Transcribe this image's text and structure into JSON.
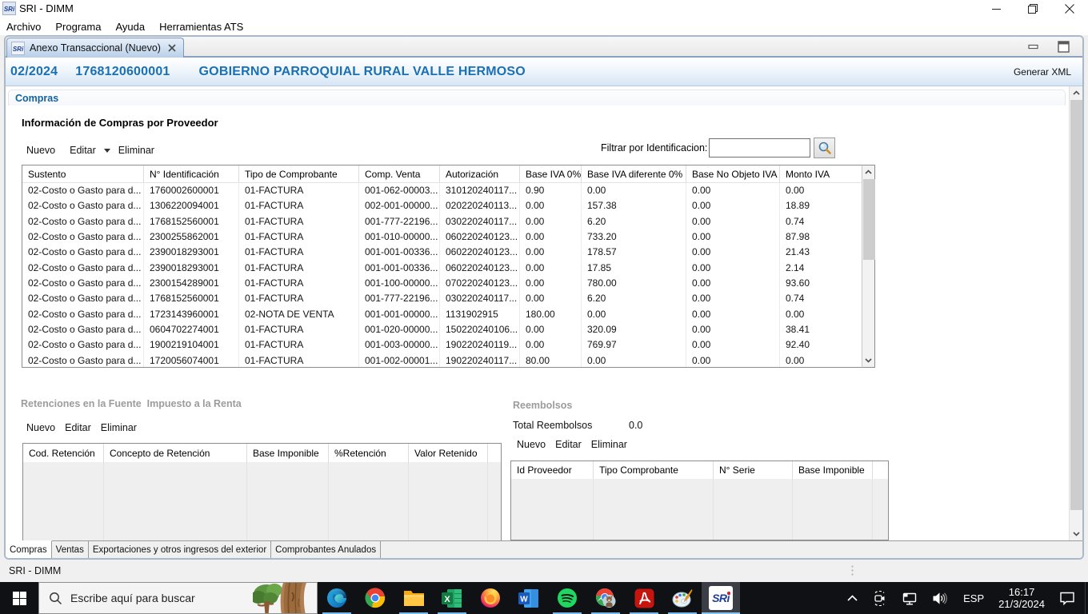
{
  "window": {
    "title": "SRI - DIMM",
    "logo_text": "SRi",
    "controls": [
      "minimize",
      "restore",
      "close"
    ]
  },
  "menu": {
    "items": [
      "Archivo",
      "Programa",
      "Ayuda",
      "Herramientas ATS"
    ]
  },
  "editor_tab": {
    "logo_text": "SRi",
    "label": "Anexo Transaccional (Nuevo)"
  },
  "header": {
    "period": "02/2024",
    "ruc": "1768120600001",
    "entity": "GOBIERNO PARROQUIAL RURAL VALLE HERMOSO",
    "generate_xml_label": "Generar XML"
  },
  "compras": {
    "section_title": "Compras",
    "subtitle": "Información de Compras por Proveedor",
    "toolbar": {
      "new": "Nuevo",
      "edit": "Editar",
      "delete": "Eliminar"
    },
    "filter": {
      "label": "Filtrar por Identificacion:",
      "value": "",
      "button_icon": "magnifier-icon"
    },
    "table": {
      "headers": [
        "Sustento",
        "N° Identificación",
        "Tipo de Comprobante",
        "Comp. Venta",
        "Autorización",
        "Base IVA 0%",
        "Base IVA diferente 0%",
        "Base No Objeto IVA",
        "Monto IVA"
      ],
      "rows": [
        [
          "02-Costo o Gasto para d...",
          "1760002600001",
          "01-FACTURA",
          "001-062-00003...",
          "310120240117...",
          "0.90",
          "0.00",
          "0.00",
          "0.00"
        ],
        [
          "02-Costo o Gasto para d...",
          "1306220094001",
          "01-FACTURA",
          "002-001-00000...",
          "020220240113...",
          "0.00",
          "157.38",
          "0.00",
          "18.89"
        ],
        [
          "02-Costo o Gasto para d...",
          "1768152560001",
          "01-FACTURA",
          "001-777-22196...",
          "030220240117...",
          "0.00",
          "6.20",
          "0.00",
          "0.74"
        ],
        [
          "02-Costo o Gasto para d...",
          "2300255862001",
          "01-FACTURA",
          "001-010-00000...",
          "060220240123...",
          "0.00",
          "733.20",
          "0.00",
          "87.98"
        ],
        [
          "02-Costo o Gasto para d...",
          "2390018293001",
          "01-FACTURA",
          "001-001-00336...",
          "060220240123...",
          "0.00",
          "178.57",
          "0.00",
          "21.43"
        ],
        [
          "02-Costo o Gasto para d...",
          "2390018293001",
          "01-FACTURA",
          "001-001-00336...",
          "060220240123...",
          "0.00",
          "17.85",
          "0.00",
          "2.14"
        ],
        [
          "02-Costo o Gasto para d...",
          "2300154289001",
          "01-FACTURA",
          "001-100-00000...",
          "070220240123...",
          "0.00",
          "780.00",
          "0.00",
          "93.60"
        ],
        [
          "02-Costo o Gasto para d...",
          "1768152560001",
          "01-FACTURA",
          "001-777-22196...",
          "030220240117...",
          "0.00",
          "6.20",
          "0.00",
          "0.74"
        ],
        [
          "02-Costo o Gasto para d...",
          "1723143960001",
          "02-NOTA DE VENTA",
          "001-001-00000...",
          "1131902915",
          "180.00",
          "0.00",
          "0.00",
          "0.00"
        ],
        [
          "02-Costo o Gasto para d...",
          "0604702274001",
          "01-FACTURA",
          "001-020-00000...",
          "150220240106...",
          "0.00",
          "320.09",
          "0.00",
          "38.41"
        ],
        [
          "02-Costo o Gasto para d...",
          "1900219104001",
          "01-FACTURA",
          "001-003-00000...",
          "190220240119...",
          "0.00",
          "769.97",
          "0.00",
          "92.40"
        ],
        [
          "02-Costo o Gasto para d...",
          "1720056074001",
          "01-FACTURA",
          "001-002-00001...",
          "190220240117...",
          "80.00",
          "0.00",
          "0.00",
          "0.00"
        ]
      ]
    }
  },
  "retenciones": {
    "section_title": "Retenciones en la Fuente  Impuesto a la Renta",
    "toolbar": {
      "new": "Nuevo",
      "edit": "Editar",
      "delete": "Eliminar"
    },
    "table": {
      "headers": [
        "Cod. Retención",
        "Concepto de Retención",
        "Base Imponible",
        "%Retención",
        "Valor Retenido"
      ],
      "rows": []
    }
  },
  "reembolsos": {
    "section_title": "Reembolsos",
    "total_label": "Total Reembolsos",
    "total_value": "0.0",
    "toolbar": {
      "new": "Nuevo",
      "edit": "Editar",
      "delete": "Eliminar"
    },
    "table": {
      "headers": [
        "Id Proveedor",
        "Tipo Comprobante",
        "N° Serie",
        "Base Imponible"
      ],
      "rows": []
    }
  },
  "bottom_tabs": {
    "tabs": [
      {
        "label": "Compras",
        "active": true
      },
      {
        "label": "Ventas",
        "active": false
      },
      {
        "label": "Exportaciones y otros ingresos del exterior",
        "active": false
      },
      {
        "label": "Comprobantes Anulados",
        "active": false
      }
    ]
  },
  "statusbar": {
    "text": "SRI - DIMM"
  },
  "taskbar": {
    "start_icon": "windows-logo-icon",
    "search": {
      "icon": "search-icon",
      "placeholder": "Escribe aquí para buscar",
      "art": "tree-illustration"
    },
    "apps": [
      {
        "name": "edge",
        "running": true,
        "active": false
      },
      {
        "name": "chrome",
        "running": false,
        "active": false
      },
      {
        "name": "file-explorer",
        "running": true,
        "active": false
      },
      {
        "name": "excel",
        "running": true,
        "active": false
      },
      {
        "name": "firefox",
        "running": false,
        "active": false
      },
      {
        "name": "word",
        "running": false,
        "active": false
      },
      {
        "name": "spotify",
        "running": true,
        "active": false
      },
      {
        "name": "chrome-profile",
        "running": true,
        "active": false
      },
      {
        "name": "acrobat",
        "running": true,
        "active": false
      },
      {
        "name": "paint",
        "running": true,
        "active": false
      },
      {
        "name": "sri-dimm",
        "running": true,
        "active": true,
        "logo_text": "SRi"
      }
    ],
    "tray": {
      "icons": [
        "chevron-up-icon",
        "meet-now-icon",
        "network-icon",
        "volume-icon"
      ],
      "language": "ESP",
      "time": "16:17",
      "date": "21/3/2024",
      "notification_icon": "notification-icon"
    }
  }
}
